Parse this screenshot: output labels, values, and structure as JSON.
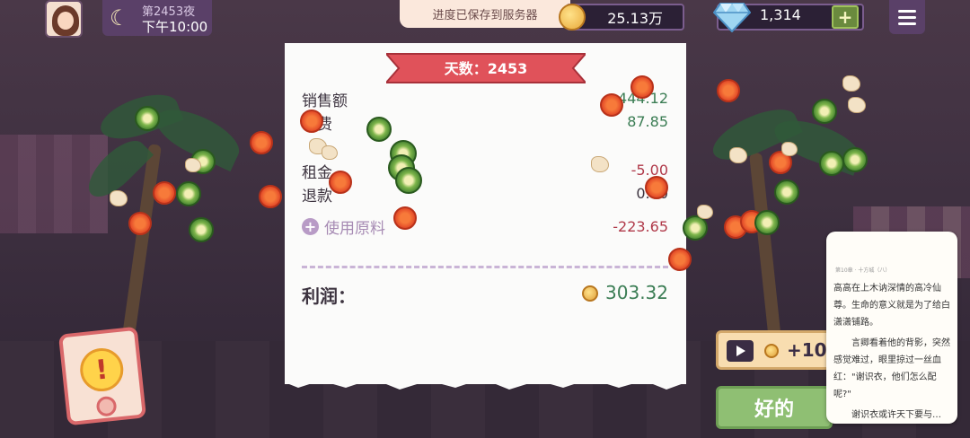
{
  "hud": {
    "night_label": "第2453夜",
    "clock": "下午10:00",
    "save_toast": "进度已保存到服务器",
    "coins": "25.13万",
    "gems": "1,314",
    "plus_symbol": "+"
  },
  "receipt": {
    "day_title": "天数：2453",
    "rows": [
      {
        "label": "销售额",
        "value": "444.12",
        "tone": "pos"
      },
      {
        "label": "小费",
        "value": "87.85",
        "tone": "pos"
      },
      {
        "label": "租金",
        "value": "-5.00",
        "tone": "neg"
      },
      {
        "label": "退款",
        "value": "0.00",
        "tone": "neutral"
      }
    ],
    "ingredients_label": "使用原料",
    "ingredients_value": "-223.65",
    "profit_label": "利润：",
    "profit_value": "303.32"
  },
  "actions": {
    "ad_reward": "+10",
    "ok_label": "好的",
    "alert_symbol": "!"
  },
  "reader": {
    "header": "第10章 · 十方城（八）",
    "paragraphs": [
      "高高在上木讷深情的高冷仙尊。生命的意义就是为了给白潇潇铺路。",
      "言卿看着他的背影，突然感觉难过，眼里掠过一丝血红：\"谢识衣，他们怎么配呢?\"",
      "谢识衣或许天下要与…"
    ]
  },
  "colors": {
    "positive": "#3b7d54",
    "negative": "#b03a4a",
    "banner": "#e0525a",
    "ok_button": "#8fbf73"
  }
}
